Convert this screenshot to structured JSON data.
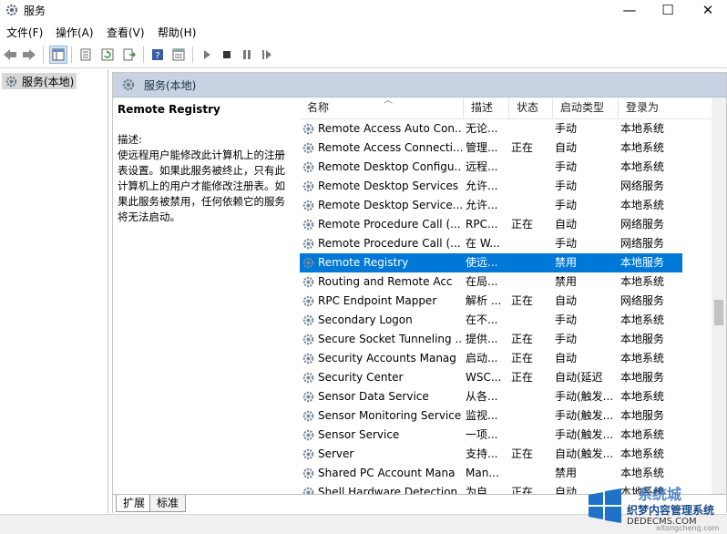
{
  "window": {
    "title": "服务",
    "minimize": "—",
    "maximize": "☐",
    "close": "✕"
  },
  "menu": [
    "文件(F)",
    "操作(A)",
    "查看(V)",
    "帮助(H)"
  ],
  "tree": {
    "root_label": "服务(本地)"
  },
  "panel": {
    "header_label": "服务(本地)",
    "selected_service_title": "Remote Registry",
    "description_label": "描述:",
    "description_text": "使远程用户能修改此计算机上的注册表设置。如果此服务被终止，只有此计算机上的用户才能修改注册表。如果此服务被禁用，任何依赖它的服务将无法启动。"
  },
  "columns": {
    "name": "名称",
    "description": "描述",
    "status": "状态",
    "startup": "启动类型",
    "logon": "登录为"
  },
  "services": [
    {
      "name": "Remote Access Auto Con...",
      "desc": "无论...",
      "status": "",
      "startup": "手动",
      "logon": "本地系统"
    },
    {
      "name": "Remote Access Connecti...",
      "desc": "管理...",
      "status": "正在",
      "startup": "自动",
      "logon": "本地系统"
    },
    {
      "name": "Remote Desktop Configu...",
      "desc": "远程...",
      "status": "",
      "startup": "手动",
      "logon": "本地系统"
    },
    {
      "name": "Remote Desktop Services",
      "desc": "允许...",
      "status": "",
      "startup": "手动",
      "logon": "网络服务"
    },
    {
      "name": "Remote Desktop Service...",
      "desc": "允许...",
      "status": "",
      "startup": "手动",
      "logon": "本地系统"
    },
    {
      "name": "Remote Procedure Call (...",
      "desc": "RPC...",
      "status": "正在",
      "startup": "自动",
      "logon": "网络服务"
    },
    {
      "name": "Remote Procedure Call (...",
      "desc": "在 W...",
      "status": "",
      "startup": "手动",
      "logon": "网络服务"
    },
    {
      "name": "Remote Registry",
      "desc": "使远...",
      "status": "",
      "startup": "禁用",
      "logon": "本地服务"
    },
    {
      "name": "Routing and Remote Acc",
      "desc": "在局...",
      "status": "",
      "startup": "禁用",
      "logon": "本地系统"
    },
    {
      "name": "RPC Endpoint Mapper",
      "desc": "解析 ...",
      "status": "正在",
      "startup": "自动",
      "logon": "网络服务"
    },
    {
      "name": "Secondary Logon",
      "desc": "在不...",
      "status": "",
      "startup": "手动",
      "logon": "本地系统"
    },
    {
      "name": "Secure Socket Tunneling ...",
      "desc": "提供...",
      "status": "正在",
      "startup": "手动",
      "logon": "本地服务"
    },
    {
      "name": "Security Accounts Manag",
      "desc": "启动...",
      "status": "正在",
      "startup": "自动",
      "logon": "本地系统"
    },
    {
      "name": "Security Center",
      "desc": "WSC...",
      "status": "正在",
      "startup": "自动(延迟",
      "logon": "本地服务"
    },
    {
      "name": "Sensor Data Service",
      "desc": "从各...",
      "status": "",
      "startup": "手动(触发...",
      "logon": "本地系统"
    },
    {
      "name": "Sensor Monitoring Service",
      "desc": "监视...",
      "status": "",
      "startup": "手动(触发...",
      "logon": "本地服务"
    },
    {
      "name": "Sensor Service",
      "desc": "一项...",
      "status": "",
      "startup": "手动(触发...",
      "logon": "本地系统"
    },
    {
      "name": "Server",
      "desc": "支持...",
      "status": "正在",
      "startup": "自动(触发...",
      "logon": "本地系统"
    },
    {
      "name": "Shared PC Account Mana",
      "desc": "Man...",
      "status": "",
      "startup": "禁用",
      "logon": "本地系统"
    },
    {
      "name": "Shell Hardware Detection",
      "desc": "为自...",
      "status": "正在",
      "startup": "自动",
      "logon": "本地系统"
    }
  ],
  "selected_index": 7,
  "tabs": [
    "扩展",
    "标准"
  ],
  "watermark": {
    "line1": "系统城",
    "line2": "xitongcheng.com",
    "line3": "织梦内容管理系统",
    "line4": "DEDECMS.COM"
  },
  "colors": {
    "selection": "#0078d7",
    "header_band": "#c7d3e2"
  }
}
